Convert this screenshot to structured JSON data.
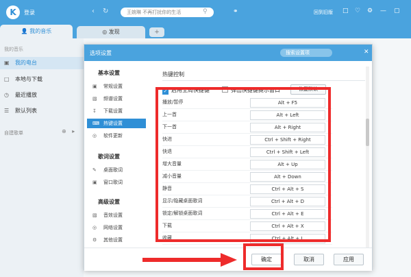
{
  "app": {
    "logo": "K",
    "login": "登录",
    "search_placeholder": "王婉琳 不再打扰你的生活",
    "back_to_old": "回到旧版",
    "tabs": {
      "my_music": "我的音乐",
      "discover": "发现",
      "plus": "+"
    }
  },
  "sidebar": {
    "title": "我的音乐",
    "items": [
      {
        "label": "我的电台",
        "icon": "radio-icon",
        "active": true
      },
      {
        "label": "本地与下载",
        "icon": "download-icon",
        "active": false
      },
      {
        "label": "最近播放",
        "icon": "clock-icon",
        "active": false
      },
      {
        "label": "默认列表",
        "icon": "list-icon",
        "active": false
      }
    ],
    "created_playlists": "自建歌单"
  },
  "dialog": {
    "title": "选项设置",
    "search_placeholder": "搜索设置项",
    "nav": {
      "groups": [
        {
          "title": "基本设置",
          "items": [
            "常规设置",
            "频谱设置",
            "下载设置",
            "热键设置",
            "软件更新"
          ]
        },
        {
          "title": "歌词设置",
          "items": [
            "桌面歌词",
            "窗口歌词"
          ]
        },
        {
          "title": "高级设置",
          "items": [
            "音效设置",
            "网络设置",
            "其他设置"
          ]
        }
      ],
      "active": "热键设置"
    },
    "hotkey": {
      "section_title": "热键控制",
      "enable_global": "启用全局快捷键",
      "popup_hint": "弹出快捷键提示窗口",
      "restore_default": "恢复默认",
      "rows": [
        {
          "action": "播放/暂停",
          "key": "Alt + F5"
        },
        {
          "action": "上一首",
          "key": "Alt + Left"
        },
        {
          "action": "下一首",
          "key": "Alt + Right"
        },
        {
          "action": "快进",
          "key": "Ctrl + Shift + Right"
        },
        {
          "action": "快退",
          "key": "Ctrl + Shift + Left"
        },
        {
          "action": "增大音量",
          "key": "Alt + Up"
        },
        {
          "action": "减小音量",
          "key": "Alt + Down"
        },
        {
          "action": "静音",
          "key": "Ctrl + Alt + S"
        },
        {
          "action": "显示/隐藏桌面歌词",
          "key": "Ctrl + Alt + D"
        },
        {
          "action": "锁定/解锁桌面歌词",
          "key": "Ctrl + Alt + E"
        },
        {
          "action": "下载",
          "key": "Ctrl + Alt + X"
        },
        {
          "action": "收藏",
          "key": "Ctrl + Alt + L"
        }
      ]
    },
    "buttons": {
      "ok": "确定",
      "cancel": "取消",
      "apply": "应用"
    }
  },
  "colors": {
    "accent": "#4aa3de",
    "highlight": "#ee2b2b"
  }
}
